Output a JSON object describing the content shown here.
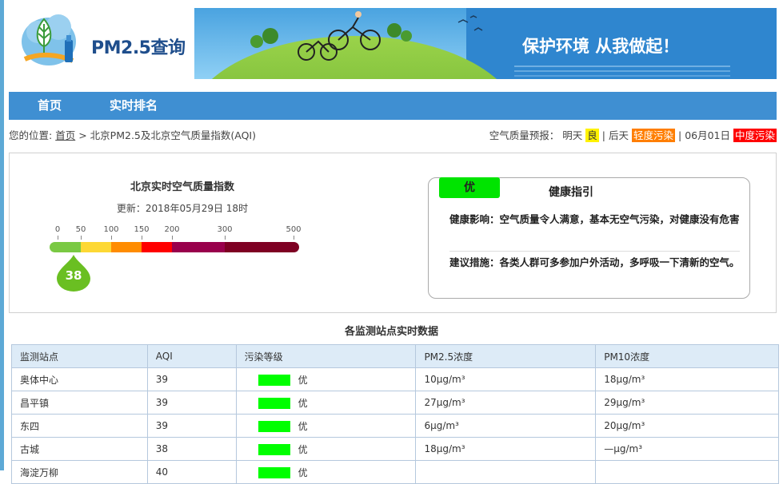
{
  "header": {
    "logo_text": "PM2.5查询",
    "banner_slogan": "保护环境  从我做起！"
  },
  "nav": {
    "items": [
      "首页",
      "实时排名"
    ]
  },
  "breadcrumb": {
    "prefix": "您的位置:",
    "home": "首页",
    "separator": ">",
    "current": "北京PM2.5及北京空气质量指数(AQI)"
  },
  "forecast": {
    "label": "空气质量预报：",
    "tomorrow_label": "明天",
    "tomorrow_value": "良",
    "sep1": "|",
    "day_after_label": "后天",
    "day_after_value": "轻度污染",
    "sep2": "|",
    "date_label": "06月01日",
    "date_value": "中度污染",
    "colors": {
      "good": "#fff200",
      "light": "#ff7e00",
      "moderate": "#ff0000"
    }
  },
  "aqi": {
    "title": "北京实时空气质量指数",
    "update": "更新：2018年05月29日 18时",
    "value": "38",
    "scale_labels": [
      "0",
      "50",
      "100",
      "150",
      "200",
      "300",
      "500"
    ],
    "scale_colors": [
      "#7ac943",
      "#fdd835",
      "#ff8c00",
      "#ff0000",
      "#99004c",
      "#7e0023"
    ]
  },
  "guide": {
    "badge": "优",
    "title": "健康指引",
    "impact": "健康影响：空气质量令人满意，基本无空气污染，对健康没有危害",
    "advice": "建议措施：各类人群可多参加户外活动，多呼吸一下清新的空气。",
    "badge_color": "#00e400"
  },
  "stations": {
    "title": "各监测站点实时数据",
    "columns": [
      "监测站点",
      "AQI",
      "污染等级",
      "PM2.5浓度",
      "PM10浓度"
    ],
    "rows": [
      {
        "name": "奥体中心",
        "aqi": "39",
        "level": "优",
        "pm25": "10μg/m³",
        "pm10": "18μg/m³"
      },
      {
        "name": "昌平镇",
        "aqi": "39",
        "level": "优",
        "pm25": "27μg/m³",
        "pm10": "29μg/m³"
      },
      {
        "name": "东四",
        "aqi": "39",
        "level": "优",
        "pm25": "6μg/m³",
        "pm10": "20μg/m³"
      },
      {
        "name": "古城",
        "aqi": "38",
        "level": "优",
        "pm25": "18μg/m³",
        "pm10": "—μg/m³"
      },
      {
        "name": "海淀万柳",
        "aqi": "40",
        "level": "优",
        "pm25": "",
        "pm10": ""
      }
    ],
    "level_color": "#00ff00"
  }
}
